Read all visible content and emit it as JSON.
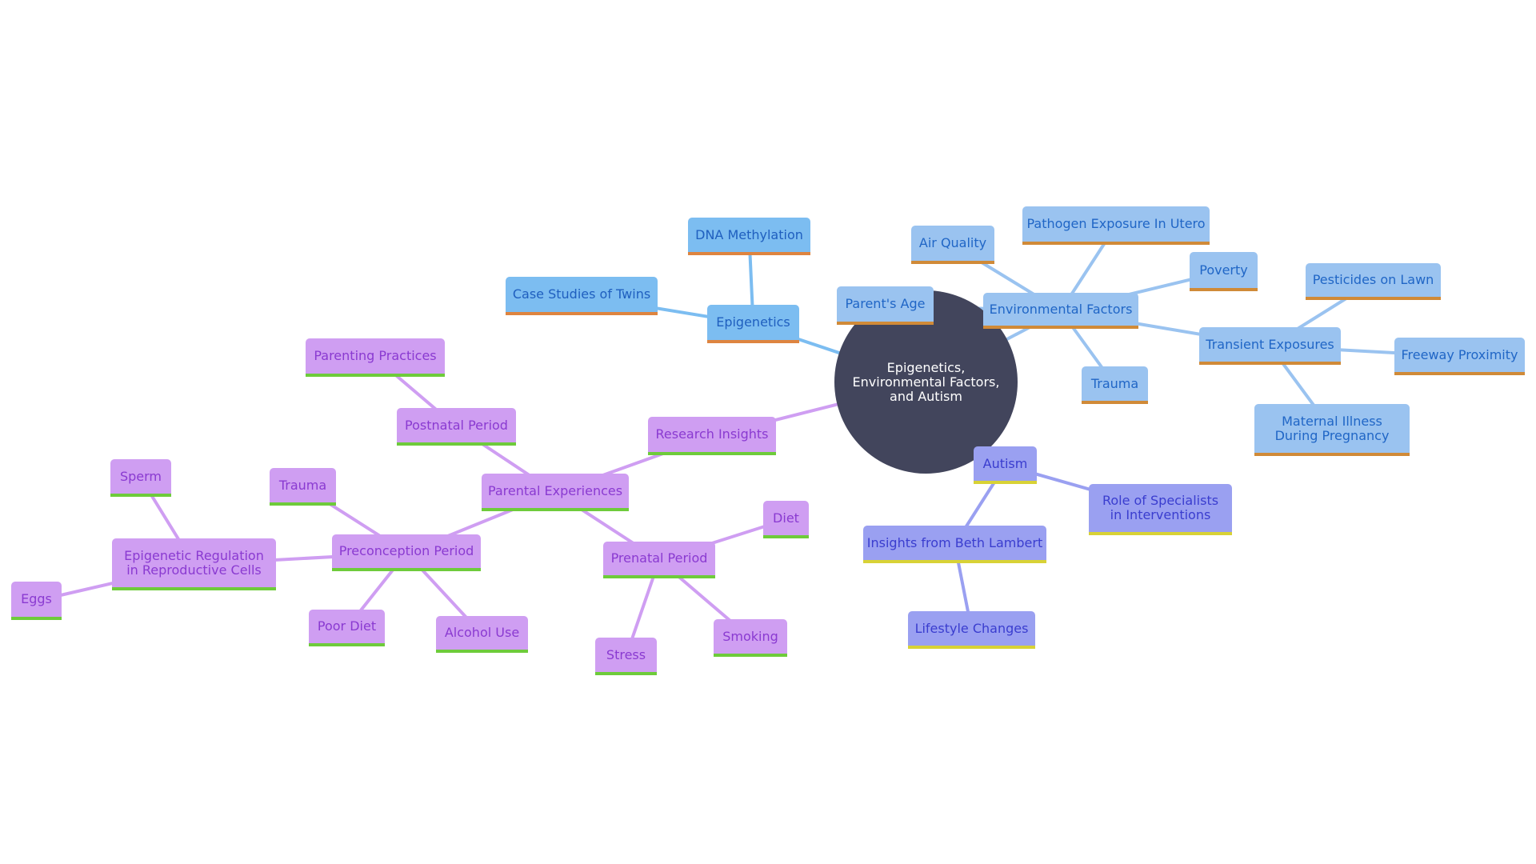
{
  "diagram": {
    "type": "mindmap",
    "center": {
      "id": "root",
      "label": "Epigenetics, Environmental Factors, and Autism"
    },
    "nodes": [
      {
        "id": "epigenetics",
        "label": "Epigenetics",
        "group": "epi",
        "parent": "root"
      },
      {
        "id": "dna",
        "label": "DNA Methylation",
        "group": "epi",
        "parent": "epigenetics"
      },
      {
        "id": "twins",
        "label": "Case Studies of Twins",
        "group": "epi",
        "parent": "epigenetics"
      },
      {
        "id": "env",
        "label": "Environmental Factors",
        "group": "env",
        "parent": "root"
      },
      {
        "id": "parentsage",
        "label": "Parent's Age",
        "group": "env",
        "parent": "env"
      },
      {
        "id": "air",
        "label": "Air Quality",
        "group": "env",
        "parent": "env"
      },
      {
        "id": "pathogen",
        "label": "Pathogen Exposure In Utero",
        "group": "env",
        "parent": "env"
      },
      {
        "id": "poverty",
        "label": "Poverty",
        "group": "env",
        "parent": "env"
      },
      {
        "id": "trauma_env",
        "label": "Trauma",
        "group": "env",
        "parent": "env"
      },
      {
        "id": "transient",
        "label": "Transient Exposures",
        "group": "env",
        "parent": "env"
      },
      {
        "id": "pesticides",
        "label": "Pesticides on Lawn",
        "group": "env",
        "parent": "transient"
      },
      {
        "id": "freeway",
        "label": "Freeway Proximity",
        "group": "env",
        "parent": "transient"
      },
      {
        "id": "maternal",
        "label": "Maternal Illness During Pregnancy",
        "group": "env",
        "parent": "transient"
      },
      {
        "id": "research",
        "label": "Research Insights",
        "group": "par",
        "parent": "root"
      },
      {
        "id": "parental",
        "label": "Parental Experiences",
        "group": "par",
        "parent": "research"
      },
      {
        "id": "postnatal",
        "label": "Postnatal Period",
        "group": "par",
        "parent": "parental"
      },
      {
        "id": "parenting",
        "label": "Parenting Practices",
        "group": "par",
        "parent": "postnatal"
      },
      {
        "id": "preconception",
        "label": "Preconception Period",
        "group": "par",
        "parent": "parental"
      },
      {
        "id": "trauma_par",
        "label": "Trauma",
        "group": "par",
        "parent": "preconception"
      },
      {
        "id": "poordiet",
        "label": "Poor Diet",
        "group": "par",
        "parent": "preconception"
      },
      {
        "id": "alcohol",
        "label": "Alcohol Use",
        "group": "par",
        "parent": "preconception"
      },
      {
        "id": "epireg",
        "label": "Epigenetic Regulation in Reproductive Cells",
        "group": "par",
        "parent": "preconception"
      },
      {
        "id": "sperm",
        "label": "Sperm",
        "group": "par",
        "parent": "epireg"
      },
      {
        "id": "eggs",
        "label": "Eggs",
        "group": "par",
        "parent": "epireg"
      },
      {
        "id": "prenatal",
        "label": "Prenatal Period",
        "group": "par",
        "parent": "parental"
      },
      {
        "id": "diet",
        "label": "Diet",
        "group": "par",
        "parent": "prenatal"
      },
      {
        "id": "stress",
        "label": "Stress",
        "group": "par",
        "parent": "prenatal"
      },
      {
        "id": "smoking",
        "label": "Smoking",
        "group": "par",
        "parent": "prenatal"
      },
      {
        "id": "autism",
        "label": "Autism",
        "group": "aut",
        "parent": "root"
      },
      {
        "id": "specialists",
        "label": "Role of Specialists in Interventions",
        "group": "aut",
        "parent": "autism"
      },
      {
        "id": "beth",
        "label": "Insights from Beth Lambert",
        "group": "aut",
        "parent": "autism"
      },
      {
        "id": "lifestyle",
        "label": "Lifestyle Changes",
        "group": "aut",
        "parent": "beth"
      }
    ],
    "group_colors": {
      "epi": {
        "fill": "#7cbdf1",
        "text": "#1f5fbf",
        "accent": "#de8440",
        "edge": "#7cbdf1"
      },
      "env": {
        "fill": "#9ac3f0",
        "text": "#2066c6",
        "accent": "#d08a38",
        "edge": "#9ac3f0"
      },
      "par": {
        "fill": "#cf9ef2",
        "text": "#8a3ad1",
        "accent": "#6ecb3b",
        "edge": "#cf9ef2"
      },
      "aut": {
        "fill": "#9aa0f1",
        "text": "#3a3dcf",
        "accent": "#d8d236",
        "edge": "#9aa0f1"
      },
      "center": {
        "fill": "#42455c",
        "text": "#ffffff"
      }
    }
  }
}
